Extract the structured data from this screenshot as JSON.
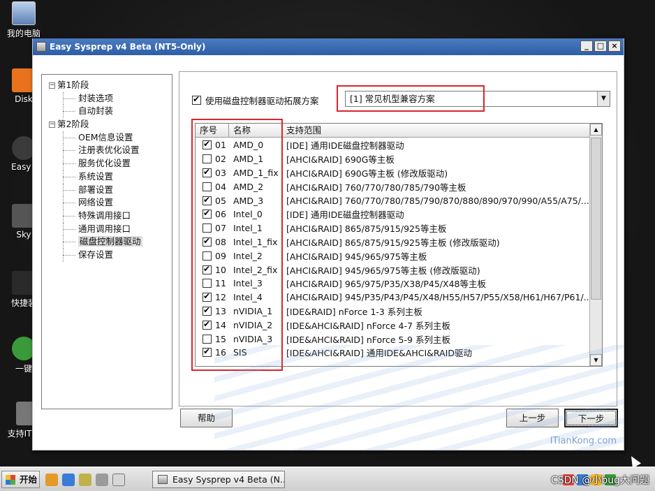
{
  "desktop": {
    "icons": [
      {
        "label": "我的电脑",
        "name": "my-computer"
      },
      {
        "label": "Disk",
        "name": "disk-tool"
      },
      {
        "label": "Easy I",
        "name": "easy-image"
      },
      {
        "label": "Sky",
        "name": "sky-tool"
      },
      {
        "label": "快捷装",
        "name": "quick-install"
      },
      {
        "label": "一键",
        "name": "one-key"
      },
      {
        "label": "支持IT天堂",
        "name": "support-ittiantang"
      }
    ]
  },
  "window": {
    "title": "Easy Sysprep v4 Beta (NT5-Only)",
    "controls": {
      "minimize": "_",
      "maximize": "□",
      "close": "×"
    }
  },
  "tree": {
    "stage1": {
      "toggle": "−",
      "label": "第1阶段",
      "children": [
        "封装选项",
        "自动封装"
      ]
    },
    "stage2": {
      "toggle": "−",
      "label": "第2阶段",
      "children": [
        "OEM信息设置",
        "注册表优化设置",
        "服务优化设置",
        "系统设置",
        "部署设置",
        "网络设置",
        "特殊调用接口",
        "通用调用接口",
        "磁盘控制器驱动",
        "保存设置"
      ],
      "selected_index": 8
    }
  },
  "options": {
    "use_scheme_label": "使用磁盘控制器驱动拓展方案",
    "use_scheme_checked": true,
    "scheme_value": "[1] 常见机型兼容方案"
  },
  "list": {
    "headers": {
      "num": "序号",
      "name": "名称",
      "range": "支持范围"
    },
    "rows": [
      {
        "checked": true,
        "num": "01",
        "name": "AMD_0",
        "range": "[IDE] 通用IDE磁盘控制器驱动"
      },
      {
        "checked": false,
        "num": "02",
        "name": "AMD_1",
        "range": "[AHCI&RAID] 690G等主板"
      },
      {
        "checked": true,
        "num": "03",
        "name": "AMD_1_fix",
        "range": "[AHCI&RAID] 690G等主板 (修改版驱动)"
      },
      {
        "checked": false,
        "num": "04",
        "name": "AMD_2",
        "range": "[AHCI&RAID] 760/770/780/785/790等主板"
      },
      {
        "checked": true,
        "num": "05",
        "name": "AMD_3",
        "range": "[AHCI&RAID] 760/770/780/785/790/870/880/890/970/990/A55/A75/..."
      },
      {
        "checked": true,
        "num": "06",
        "name": "Intel_0",
        "range": "[IDE] 通用IDE磁盘控制器驱动"
      },
      {
        "checked": false,
        "num": "07",
        "name": "Intel_1",
        "range": "[AHCI&RAID] 865/875/915/925等主板"
      },
      {
        "checked": true,
        "num": "08",
        "name": "Intel_1_fix",
        "range": "[AHCI&RAID] 865/875/915/925等主板 (修改版驱动)"
      },
      {
        "checked": false,
        "num": "09",
        "name": "Intel_2",
        "range": "[AHCI&RAID] 945/965/975等主板"
      },
      {
        "checked": true,
        "num": "10",
        "name": "Intel_2_fix",
        "range": "[AHCI&RAID] 945/965/975等主板 (修改版驱动)"
      },
      {
        "checked": false,
        "num": "11",
        "name": "Intel_3",
        "range": "[AHCI&RAID] 965/975/P35/X38/P45/X48等主板"
      },
      {
        "checked": true,
        "num": "12",
        "name": "Intel_4",
        "range": "[AHCI&RAID] 945/P35/P43/P45/X48/H55/H57/P55/X58/H61/H67/P61/..."
      },
      {
        "checked": true,
        "num": "13",
        "name": "nVIDIA_1",
        "range": "[IDE&RAID] nForce 1-3 系列主板"
      },
      {
        "checked": true,
        "num": "14",
        "name": "nVIDIA_2",
        "range": "[IDE&AHCI&RAID] nForce 4-7 系列主板"
      },
      {
        "checked": false,
        "num": "15",
        "name": "nVIDIA_3",
        "range": "[IDE&AHCI&RAID] nForce 5-9 系列主板"
      },
      {
        "checked": true,
        "num": "16",
        "name": "SIS",
        "range": "[IDE&AHCI&RAID] 通用IDE&AHCI&RAID驱动"
      }
    ]
  },
  "buttons": {
    "help": "帮助",
    "prev": "上一步",
    "next": "下一步"
  },
  "watermark": "ITianKong.com",
  "taskbar": {
    "start": "开始",
    "task_item": "Easy Sysprep v4 Beta (N...",
    "overlay_text": "CSDN @小bug大问题"
  },
  "colors": {
    "highlight_box": "#d9262c",
    "titlebar": "#2d5ea6"
  }
}
